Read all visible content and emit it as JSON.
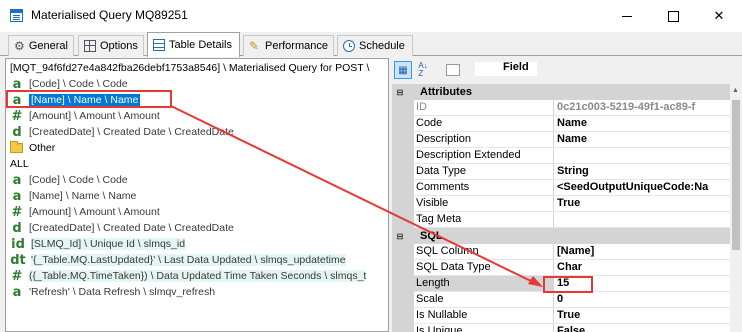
{
  "window": {
    "title": "Materialised Query MQ89251",
    "controls": [
      "minimize-icon",
      "maximize-icon",
      "close-icon"
    ]
  },
  "tabs": [
    {
      "label": "General",
      "icon": "gear-icon"
    },
    {
      "label": "Options",
      "icon": "grid-icon"
    },
    {
      "label": "Table Details",
      "icon": "table-icon",
      "active": true
    },
    {
      "label": "Performance",
      "icon": "paint-icon"
    },
    {
      "label": "Schedule",
      "icon": "clock-icon"
    }
  ],
  "tree": {
    "root": "[MQT_94f6fd27e4a842fba26debf1753a8546] \\ Materialised Query for POST \\",
    "items": [
      {
        "icon": "a",
        "text": "[Code] \\ Code \\ Code"
      },
      {
        "icon": "a",
        "text": "[Name] \\ Name \\ Name",
        "selected": true
      },
      {
        "icon": "#",
        "text": "[Amount] \\ Amount \\ Amount"
      },
      {
        "icon": "d",
        "text": "[CreatedDate] \\ Created Date \\ CreatedDate"
      }
    ],
    "folder": "Other",
    "all_label": "ALL",
    "all_items": [
      {
        "icon": "a",
        "text": "[Code] \\ Code \\ Code"
      },
      {
        "icon": "a",
        "text": "[Name] \\ Name \\ Name"
      },
      {
        "icon": "#",
        "text": "[Amount] \\ Amount \\ Amount"
      },
      {
        "icon": "d",
        "text": "[CreatedDate] \\ Created Date \\ CreatedDate"
      },
      {
        "icon": "id",
        "text": "[SLMQ_Id] \\ Unique Id \\ slmqs_id"
      },
      {
        "icon": "dt",
        "text": "'{_Table.MQ.LastUpdated}' \\ Last Data Updated \\ slmqs_updatetime"
      },
      {
        "icon": "#",
        "text": "({_Table.MQ.TimeTaken}) \\ Data Updated Time Taken Seconds \\ slmqs_t"
      },
      {
        "icon": "a",
        "text": "'Refresh' \\ Data Refresh \\ slmqv_refresh"
      }
    ]
  },
  "properties": {
    "header_label": "Field",
    "categories": [
      {
        "name": "Attributes",
        "rows": [
          {
            "name": "ID",
            "value": "0c21c003-5219-49f1-ac89-f",
            "grey": true
          },
          {
            "name": "Code",
            "value": "Name"
          },
          {
            "name": "Description",
            "value": "Name"
          },
          {
            "name": "Description Extended",
            "value": ""
          },
          {
            "name": "Data Type",
            "value": "String"
          },
          {
            "name": "Comments",
            "value": "<SeedOutputUniqueCode:Na"
          },
          {
            "name": "Visible",
            "value": "True"
          },
          {
            "name": "Tag Meta",
            "value": ""
          }
        ]
      },
      {
        "name": "SQL",
        "rows": [
          {
            "name": "SQL Column",
            "value": "[Name]"
          },
          {
            "name": "SQL Data Type",
            "value": "Char"
          },
          {
            "name": "Length",
            "value": "15",
            "selected": true
          },
          {
            "name": "Scale",
            "value": "0"
          },
          {
            "name": "Is Nullable",
            "value": "True"
          },
          {
            "name": "Is Unique",
            "value": "False"
          }
        ]
      }
    ]
  },
  "annotation_color": "#e53935"
}
